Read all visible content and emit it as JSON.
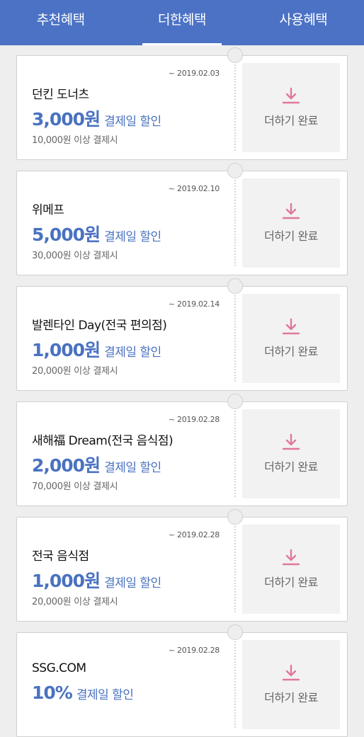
{
  "tabs": [
    {
      "label": "추천혜택"
    },
    {
      "label": "더한혜택"
    },
    {
      "label": "사용혜택"
    }
  ],
  "coupons": [
    {
      "date": "~ 2019.02.03",
      "merchant": "던킨 도너츠",
      "amount": "3,000원",
      "discount_label": "결제일 할인",
      "condition": "10,000원 이상 결제시",
      "action": "더하기 완료"
    },
    {
      "date": "~ 2019.02.10",
      "merchant": "위메프",
      "amount": "5,000원",
      "discount_label": "결제일 할인",
      "condition": "30,000원 이상 결제시",
      "action": "더하기 완료"
    },
    {
      "date": "~ 2019.02.14",
      "merchant": "발렌타인 Day(전국 편의점)",
      "amount": "1,000원",
      "discount_label": "결제일 할인",
      "condition": "20,000원 이상 결제시",
      "action": "더하기 완료"
    },
    {
      "date": "~ 2019.02.28",
      "merchant": "새해福 Dream(전국 음식점)",
      "amount": "2,000원",
      "discount_label": "결제일 할인",
      "condition": "70,000원 이상 결제시",
      "action": "더하기 완료"
    },
    {
      "date": "~ 2019.02.28",
      "merchant": "전국 음식점",
      "amount": "1,000원",
      "discount_label": "결제일 할인",
      "condition": "20,000원 이상 결제시",
      "action": "더하기 완료"
    },
    {
      "date": "~ 2019.02.28",
      "merchant": "SSG.COM",
      "amount": "10%",
      "discount_label": "결제일 할인",
      "condition": "",
      "action": "더하기 완료"
    }
  ],
  "colors": {
    "header": "#4b72c5",
    "accent": "#4a72c0",
    "icon": "#e0789a"
  }
}
